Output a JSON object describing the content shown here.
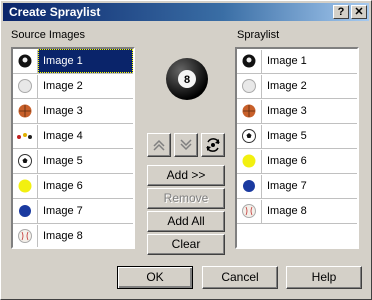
{
  "window": {
    "title": "Create Spraylist",
    "help_btn": "?",
    "close_btn": "✕"
  },
  "source": {
    "label": "Source Images",
    "items": [
      {
        "label": "Image 1",
        "icon": "eightball-icon",
        "selected": true
      },
      {
        "label": "Image 2",
        "icon": "golfball-icon"
      },
      {
        "label": "Image 3",
        "icon": "basketball-icon"
      },
      {
        "label": "Image 4",
        "icon": "billiards-icon"
      },
      {
        "label": "Image 5",
        "icon": "soccerball-icon"
      },
      {
        "label": "Image 6",
        "icon": "tennisball-icon"
      },
      {
        "label": "Image 7",
        "icon": "blueball-icon"
      },
      {
        "label": "Image 8",
        "icon": "baseball-icon"
      }
    ]
  },
  "spraylist": {
    "label": "Spraylist",
    "items": [
      {
        "label": "Image 1",
        "icon": "eightball-icon"
      },
      {
        "label": "Image 2",
        "icon": "golfball-icon"
      },
      {
        "label": "Image 3",
        "icon": "basketball-icon"
      },
      {
        "label": "Image 5",
        "icon": "soccerball-icon"
      },
      {
        "label": "Image 6",
        "icon": "tennisball-icon"
      },
      {
        "label": "Image 7",
        "icon": "blueball-icon"
      },
      {
        "label": "Image 8",
        "icon": "baseball-icon"
      }
    ]
  },
  "preview": {
    "number": "8"
  },
  "buttons": {
    "add": "Add >>",
    "remove": "Remove",
    "add_all": "Add All",
    "clear": "Clear",
    "ok": "OK",
    "cancel": "Cancel",
    "help": "Help"
  },
  "colors": {
    "selection": "#0a246a",
    "face": "#d4d0c8"
  }
}
